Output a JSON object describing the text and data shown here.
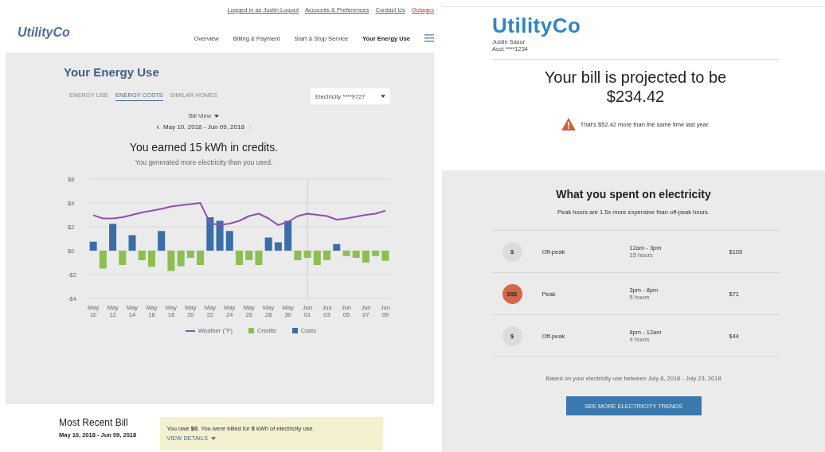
{
  "left_page": {
    "top_links": [
      "Logged in as Justin Logout",
      "Accounts & Preferences",
      "Contact Us",
      "Outages"
    ],
    "logo": "UtilityCo",
    "nav": [
      {
        "label": "Overview",
        "selected": false
      },
      {
        "label": "Billing & Payment",
        "selected": false
      },
      {
        "label": "Start & Stop Service",
        "selected": false
      },
      {
        "label": "Your Energy Use",
        "selected": true
      }
    ],
    "title": "Your Energy Use",
    "tabs": [
      {
        "label": "ENERGY USE",
        "selected": false
      },
      {
        "label": "ENERGY COSTS",
        "selected": true
      },
      {
        "label": "SIMILAR HOMES",
        "selected": false
      }
    ],
    "account_dropdown": {
      "value": "Electricity ****9727"
    },
    "view_dropdown": {
      "value": "Bill View"
    },
    "period": {
      "prev": "‹",
      "label": "May 10, 2018 - Jun 09, 2018",
      "next": "›"
    },
    "headline": "You earned 15 kWh in credits.",
    "subheadline": "You generated more electricity than you used.",
    "chart_data": {
      "type": "bar",
      "stacked": true,
      "grid": true,
      "categories": [
        "May 10",
        null,
        "May 12",
        null,
        "May 14",
        null,
        "May 16",
        null,
        "May 18",
        null,
        "May 20",
        null,
        "May 22",
        null,
        "May 24",
        null,
        "May 26",
        null,
        "May 28",
        null,
        "May 30",
        null,
        "Jun 01",
        null,
        "Jun 03",
        null,
        "Jun 05",
        null,
        "Jun 07",
        null,
        "Jun 09"
      ],
      "series": [
        {
          "name": "Weather (°F)",
          "type": "line",
          "color": "#8e4fb5",
          "values": [
            2.97,
            2.7,
            2.7,
            2.8,
            3.0,
            3.2,
            3.35,
            3.5,
            3.7,
            3.8,
            3.9,
            4.0,
            2.3,
            2.15,
            2.27,
            2.5,
            2.9,
            3.1,
            2.7,
            2.15,
            2.4,
            2.9,
            3.1,
            3.0,
            2.9,
            2.6,
            2.7,
            2.85,
            3.0,
            3.1,
            3.35
          ]
        },
        {
          "name": "Credits",
          "color": "#8cbf4f",
          "values": [
            null,
            -1.5,
            null,
            -1.2,
            null,
            -0.8,
            -1.35,
            null,
            -1.7,
            -1.3,
            -0.6,
            -1.2,
            null,
            null,
            null,
            -1.2,
            -0.8,
            -1.2,
            null,
            null,
            null,
            -0.8,
            -0.6,
            -1.2,
            -0.8,
            null,
            -0.45,
            -0.6,
            -1.0,
            -0.45,
            -0.85
          ]
        },
        {
          "name": "Costs",
          "color": "#3b6ea8",
          "values": [
            0.75,
            null,
            2.25,
            null,
            1.3,
            null,
            null,
            1.65,
            null,
            null,
            null,
            null,
            2.8,
            2.5,
            1.65,
            null,
            null,
            null,
            1.1,
            0.7,
            2.5,
            null,
            null,
            null,
            null,
            0.55,
            null,
            null,
            null,
            null,
            null
          ]
        }
      ],
      "ylim": [
        -4,
        6
      ],
      "yticks": [
        {
          "value": 6,
          "label": "$6"
        },
        {
          "value": 4,
          "label": "$4"
        },
        {
          "value": 2,
          "label": "$2"
        },
        {
          "value": 0,
          "label": "$0"
        },
        {
          "value": -2,
          "label": "-$2"
        },
        {
          "value": -4,
          "label": "-$4"
        }
      ],
      "legend": true,
      "ref_lines": [
        {
          "axis": "x",
          "value": "Jun 01"
        }
      ]
    },
    "recent_bill": {
      "title": "Most Recent Bill",
      "period": "May 10, 2018 - Jun 09, 2018",
      "notice": "You owe **$0**. You were billed for **0** kWh of electricity use.",
      "details_link": "VIEW DETAILS"
    }
  },
  "right_page": {
    "logo": "UtilityCo",
    "customer_name": "Justin Sasor",
    "account": "Acct ****1234",
    "projection": [
      "Your bill is projected to be",
      "$234.42"
    ],
    "warning": "That's $52.42 more than the same time last year.",
    "section_title": "What you spent on electricity",
    "section_subtitle": "Peak hours are 1.5x more expensive than off-peak hours.",
    "rates": [
      {
        "badge": "$",
        "kind": "offpeak",
        "name": "Off-peak",
        "time": "12am - 3pm",
        "duration": "15 hours",
        "cost": "$105"
      },
      {
        "badge": "$$$",
        "kind": "peak",
        "name": "Peak",
        "time": "3pm - 8pm",
        "duration": "5 hours",
        "cost": "$71"
      },
      {
        "badge": "$",
        "kind": "offpeak",
        "name": "Off-peak",
        "time": "8pm - 12am",
        "duration": "4 hours",
        "cost": "$44"
      }
    ],
    "footnote": "Based on your electricity use between July 8, 2018 - July 23, 2018",
    "button": "SEE MORE ELECTRICITY TRENDS"
  }
}
